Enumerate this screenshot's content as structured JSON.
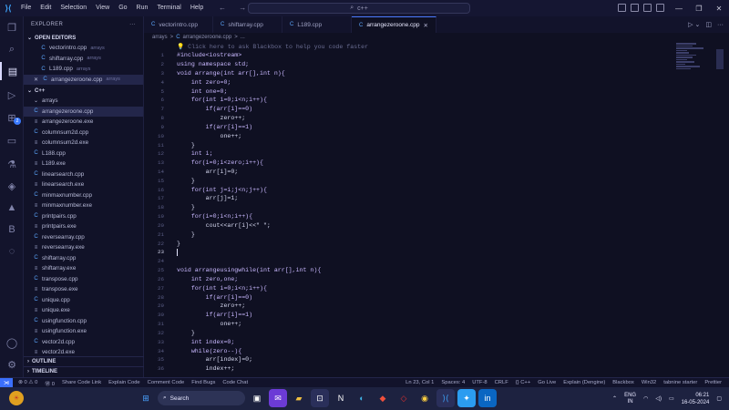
{
  "menu": [
    "File",
    "Edit",
    "Selection",
    "View",
    "Go",
    "Run",
    "Terminal",
    "Help"
  ],
  "search": {
    "text": "c++"
  },
  "sidebar": {
    "title": "EXPLORER",
    "open_editors": "OPEN EDITORS",
    "open_files": [
      {
        "name": "vectorintro.cpp",
        "dir": "arrays"
      },
      {
        "name": "shiftarray.cpp",
        "dir": "arrays"
      },
      {
        "name": "L189.cpp",
        "dir": "arrays"
      },
      {
        "name": "arrangezeroone.cpp",
        "dir": "arrays"
      }
    ],
    "folder": "C++",
    "subfolder": "arrays",
    "files": [
      "arrangezeroone.cpp",
      "arrangezeroone.exe",
      "columnsum2d.cpp",
      "columnsum2d.exe",
      "L188.cpp",
      "L189.exe",
      "linearsearch.cpp",
      "linearsearch.exe",
      "minmaxnumber.cpp",
      "minmaxnumber.exe",
      "printpairs.cpp",
      "printpairs.exe",
      "reversearray.cpp",
      "reversearray.exe",
      "shiftarray.cpp",
      "shiftarray.exe",
      "transpose.cpp",
      "transpose.exe",
      "unique.cpp",
      "unique.exe",
      "usingfunction.cpp",
      "usingfunction.exe",
      "vector2d.cpp",
      "vector2d.exe"
    ],
    "outline": "OUTLINE",
    "timeline": "TIMELINE"
  },
  "tabs": [
    {
      "name": "vectorintro.cpp"
    },
    {
      "name": "shiftarray.cpp"
    },
    {
      "name": "L189.cpp"
    },
    {
      "name": "arrangezeroone.cpp",
      "active": true
    }
  ],
  "breadcrumb": [
    "arrays",
    ">",
    "arrangezeroone.cpp",
    ">",
    "..."
  ],
  "editor": {
    "hint": "💡 Click here to ask Blackbox to help you code faster",
    "lines": [
      {
        "n": "1",
        "t": "#include<iostream>"
      },
      {
        "n": "2",
        "t": "using namespace std;"
      },
      {
        "n": "3",
        "t": "void arrange(int arr[],int n){"
      },
      {
        "n": "4",
        "t": "    int zero=0;"
      },
      {
        "n": "5",
        "t": "    int one=0;"
      },
      {
        "n": "6",
        "t": "    for(int i=0;i<n;i++){"
      },
      {
        "n": "7",
        "t": "        if(arr[i]==0)"
      },
      {
        "n": "8",
        "t": "            zero++;"
      },
      {
        "n": "9",
        "t": "        if(arr[i]==1)"
      },
      {
        "n": "10",
        "t": "            one++;"
      },
      {
        "n": "11",
        "t": "    }"
      },
      {
        "n": "12",
        "t": "    int i;"
      },
      {
        "n": "13",
        "t": "    for(i=0;i<zero;i++){"
      },
      {
        "n": "14",
        "t": "        arr[i]=0;"
      },
      {
        "n": "15",
        "t": "    }"
      },
      {
        "n": "16",
        "t": "    for(int j=i;j<n;j++){"
      },
      {
        "n": "17",
        "t": "        arr[j]=1;"
      },
      {
        "n": "18",
        "t": "    }"
      },
      {
        "n": "19",
        "t": "    for(i=0;i<n;i++){"
      },
      {
        "n": "20",
        "t": "        cout<<arr[i]<<\" \";"
      },
      {
        "n": "21",
        "t": "    }"
      },
      {
        "n": "22",
        "t": "}"
      },
      {
        "n": "23",
        "t": "",
        "cur": true
      },
      {
        "n": "24",
        "t": ""
      },
      {
        "n": "25",
        "t": "void arrangeusingwhile(int arr[],int n){"
      },
      {
        "n": "26",
        "t": "    int zero,one;"
      },
      {
        "n": "27",
        "t": "    for(int i=0;i<n;i++){"
      },
      {
        "n": "28",
        "t": "        if(arr[i]==0)"
      },
      {
        "n": "29",
        "t": "            zero++;"
      },
      {
        "n": "30",
        "t": "        if(arr[i]==1)"
      },
      {
        "n": "31",
        "t": "            one++;"
      },
      {
        "n": "32",
        "t": "    }"
      },
      {
        "n": "33",
        "t": "    int index=0;"
      },
      {
        "n": "34",
        "t": "    while(zero--){"
      },
      {
        "n": "35",
        "t": "        arr[index]=0;"
      },
      {
        "n": "36",
        "t": "        index++;"
      }
    ]
  },
  "status": {
    "left": [
      "⊗ 0 ⚠ 0",
      "Ⓦ 0",
      "Share Code Link",
      "Explain Code",
      "Comment Code",
      "Find Bugs",
      "Code Chat"
    ],
    "right": [
      "Ln 23, Col 1",
      "Spaces: 4",
      "UTF-8",
      "CRLF",
      "{} C++",
      "Go Live",
      "Explain (Dengine)",
      "Blackbox",
      "Win32",
      "tabnine starter",
      "Prettier"
    ]
  },
  "taskbar": {
    "search": "Search",
    "lang": [
      "ENG",
      "IN"
    ],
    "time": "06:21",
    "date": "16-05-2024"
  },
  "colors": {
    "accent": "#3b6ffb",
    "bg": "#0f1022",
    "keyword": "#c792ea",
    "type": "#82aaff",
    "number": "#f78c6c"
  }
}
